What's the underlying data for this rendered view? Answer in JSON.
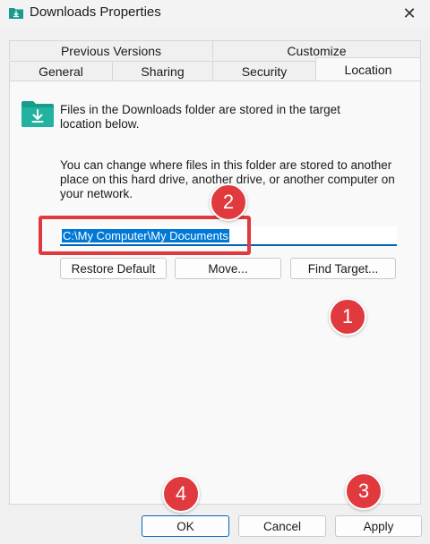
{
  "window": {
    "title": "Downloads Properties",
    "close_glyph": "✕"
  },
  "tabs": {
    "row1": [
      {
        "label": "Previous Versions"
      },
      {
        "label": "Customize"
      }
    ],
    "row2": [
      {
        "label": "General"
      },
      {
        "label": "Sharing"
      },
      {
        "label": "Security"
      },
      {
        "label": "Location",
        "active": true
      }
    ]
  },
  "location": {
    "intro": "Files in the Downloads folder are stored in the target location below.",
    "description": "You can change where files in this folder are stored to another place on this hard drive, another drive, or another computer on your network.",
    "path_value": "C:\\My Computer\\My Documents",
    "restore_label": "Restore Default",
    "move_label": "Move...",
    "find_target_label": "Find Target..."
  },
  "footer": {
    "ok_label": "OK",
    "cancel_label": "Cancel",
    "apply_label": "Apply"
  },
  "annotations": [
    "1",
    "2",
    "3",
    "4"
  ],
  "colors": {
    "accent": "#0067c0",
    "selection": "#0078d7",
    "annotation_red": "#e0393e",
    "folder_teal": "#1a9c8c"
  },
  "icons": {
    "title": "downloads-folder-icon",
    "panel": "downloads-folder-icon",
    "close": "close-icon"
  }
}
